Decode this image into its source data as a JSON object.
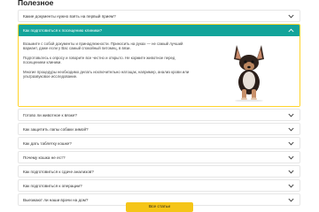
{
  "section": {
    "title": "Полезное"
  },
  "faq": {
    "expanded": {
      "question": "Как подготовиться к посещению клиники?",
      "paragraphs": [
        "Возьмите с собой документы и принадлежности. Приносить на руках — не самый лучший вариант, даже если у Вас самый спокойный питомец, в вязи.",
        "Подготовьтесь к опросу и говорите все честно и открыто. Не кормите животное перед посещением клиники.",
        "Многие процедуры необходимо делать исключительно натощак, например, анализ крови или ультразвуковое исследование."
      ]
    },
    "first": "Какие документы нужно взять на первый прием?",
    "rest": [
      "Готово ли животное к вязке?",
      "Как защитить лапы собаки зимой?",
      "Как дать таблетку кошке?",
      "Почему кошка не ест?",
      "Как подготовиться к сдаче анализов?",
      "Как подготовиться к операции?",
      "Выезжают ли наши врачи на дом?"
    ]
  },
  "button": {
    "label": "Все статьи"
  },
  "colors": {
    "accent": "#12a49a",
    "border_active": "#ffd42a",
    "button": "#f5c518"
  },
  "icons": {
    "collapsed": "chevron-down-icon",
    "expanded": "chevron-up-icon"
  }
}
